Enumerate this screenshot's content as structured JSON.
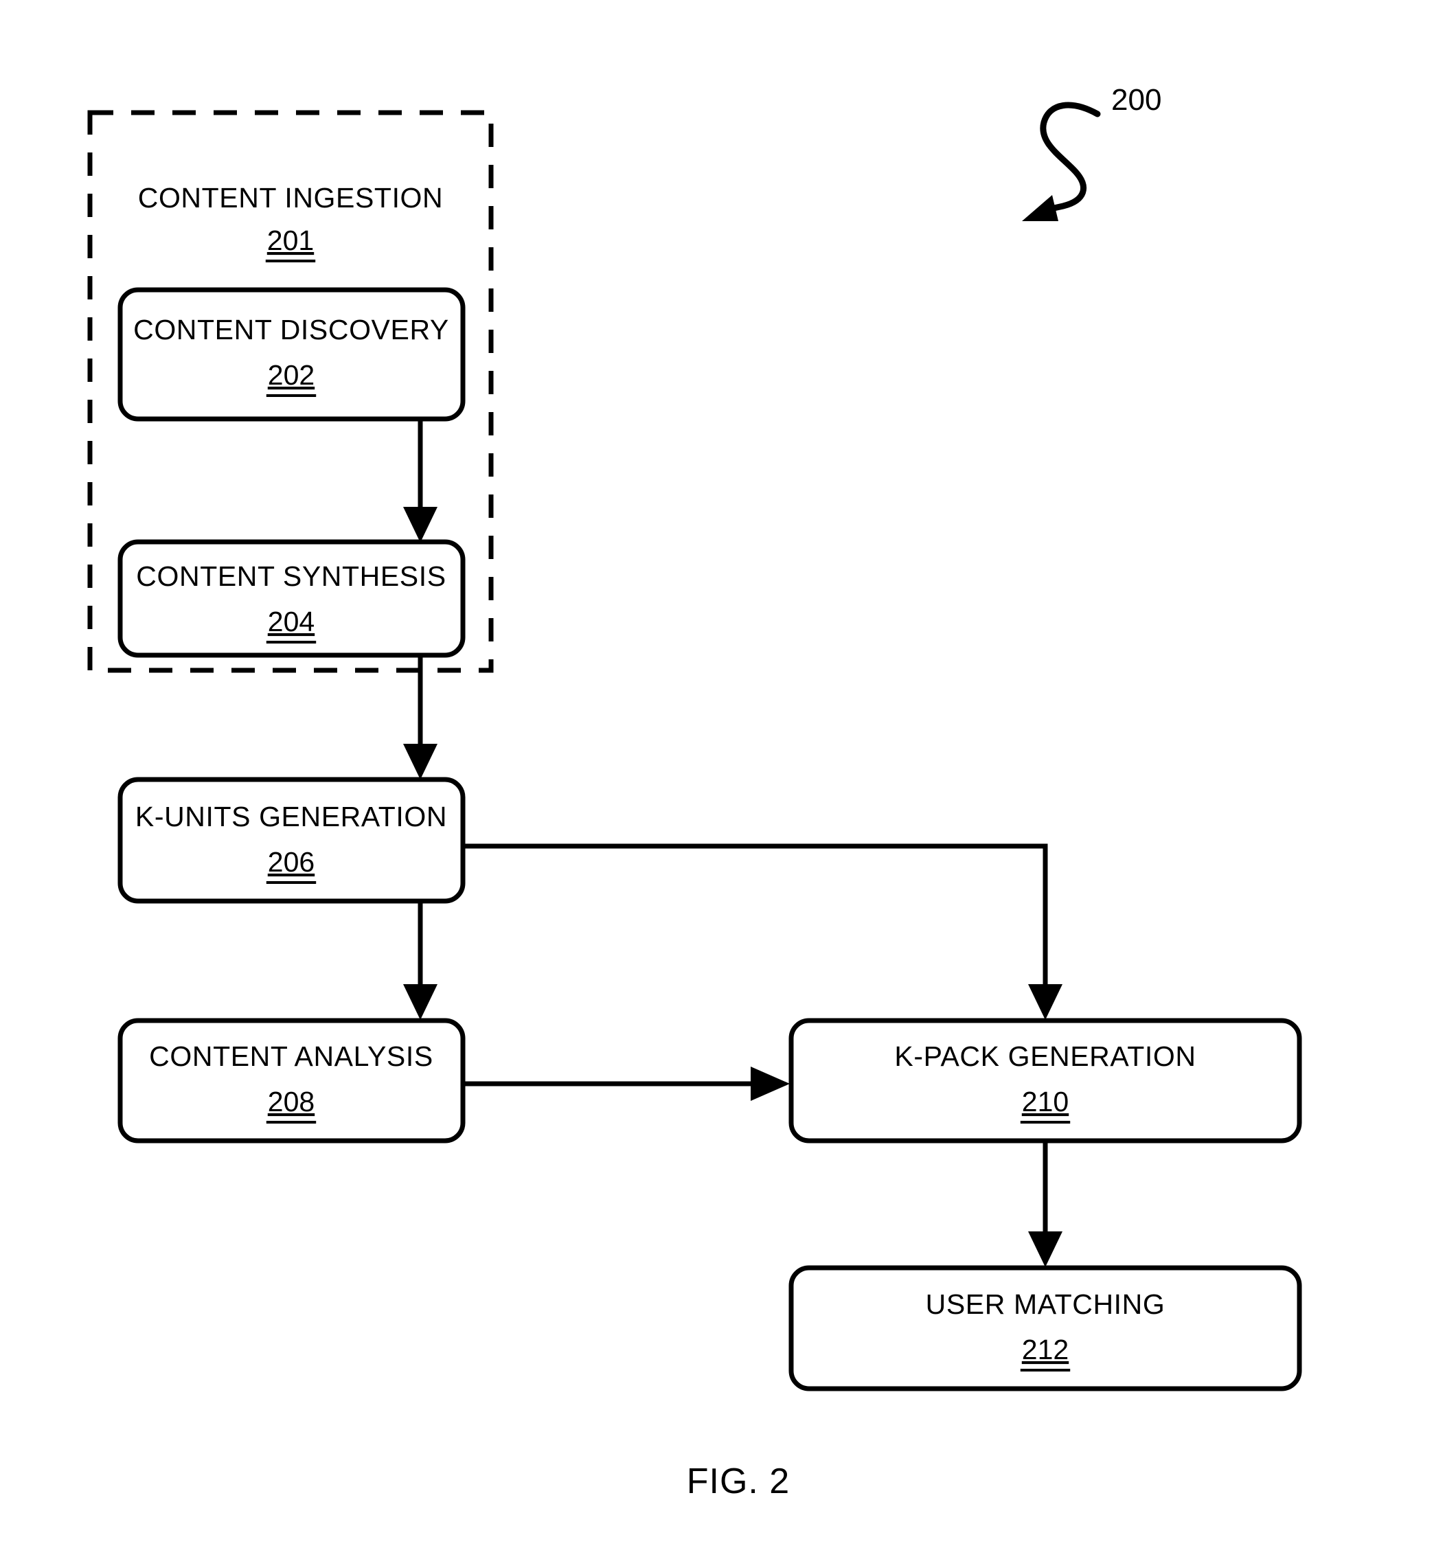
{
  "figure": {
    "caption": "FIG. 2",
    "callout_ref": "200"
  },
  "group": {
    "name": "content-ingestion-group",
    "title": "CONTENT INGESTION",
    "ref": "201",
    "border_style": "dashed"
  },
  "boxes": [
    {
      "id": "content-discovery",
      "title": "CONTENT DISCOVERY",
      "ref": "202"
    },
    {
      "id": "content-synthesis",
      "title": "CONTENT SYNTHESIS",
      "ref": "204"
    },
    {
      "id": "k-units-generation",
      "title": "K-UNITS GENERATION",
      "ref": "206"
    },
    {
      "id": "content-analysis",
      "title": "CONTENT ANALYSIS",
      "ref": "208"
    },
    {
      "id": "k-pack-generation",
      "title": "K-PACK GENERATION",
      "ref": "210"
    },
    {
      "id": "user-matching",
      "title": "USER MATCHING",
      "ref": "212"
    }
  ],
  "connections": [
    {
      "from": "content-discovery",
      "to": "content-synthesis"
    },
    {
      "from": "content-synthesis",
      "to": "k-units-generation"
    },
    {
      "from": "k-units-generation",
      "to": "content-analysis"
    },
    {
      "from": "k-units-generation",
      "to": "k-pack-generation"
    },
    {
      "from": "content-analysis",
      "to": "k-pack-generation"
    },
    {
      "from": "k-pack-generation",
      "to": "user-matching"
    }
  ],
  "colors": {
    "stroke": "#000000",
    "fill": "#ffffff",
    "background": "#ffffff"
  }
}
